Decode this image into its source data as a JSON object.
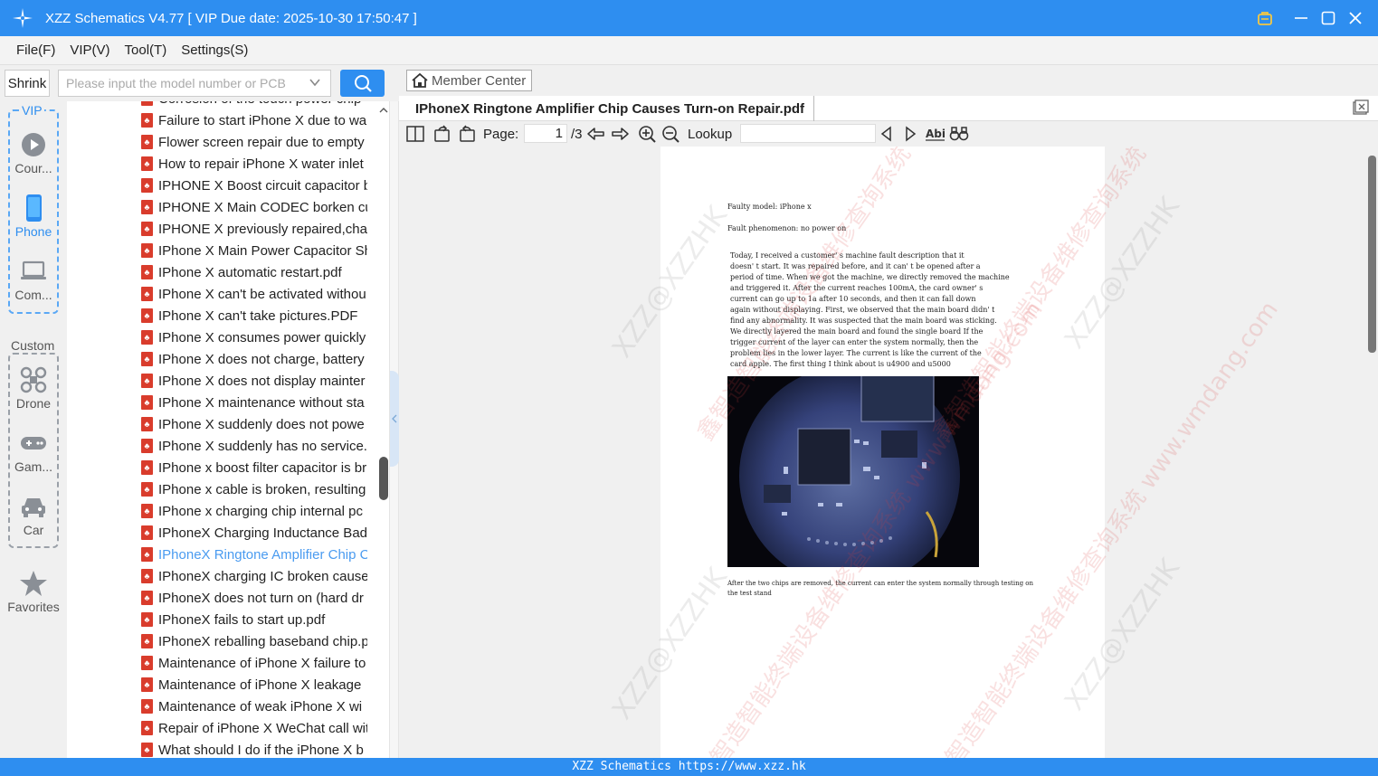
{
  "window": {
    "title": "XZZ Schematics V4.77 [ VIP Due date: 2025-10-30 17:50:47 ]"
  },
  "menu": [
    "File(F)",
    "VIP(V)",
    "Tool(T)",
    "Settings(S)"
  ],
  "toolbar": {
    "shrink_label": "Shrink",
    "search_placeholder": "Please input the model number or PCB"
  },
  "sidebar": {
    "vip_label": "VIP",
    "custom_label": "Custom",
    "items": [
      {
        "label": "Cour...",
        "icon": "play-circle-icon"
      },
      {
        "label": "Phone",
        "icon": "phone-icon"
      },
      {
        "label": "Com...",
        "icon": "laptop-icon"
      },
      {
        "label": "Drone",
        "icon": "drone-icon"
      },
      {
        "label": "Gam...",
        "icon": "gamepad-icon"
      },
      {
        "label": "Car",
        "icon": "car-icon"
      },
      {
        "label": "Favorites",
        "icon": "star-icon"
      }
    ]
  },
  "file_list": [
    "Corrosion of the touch power chip",
    "Failure to start iPhone X due to wa",
    "Flower screen repair due to empty",
    "How to repair iPhone X water inlet",
    "IPHONE X Boost circuit capacitor b",
    "IPHONE X Main CODEC borken cu",
    "IPHONE X previously repaired,char",
    "IPhone X Main Power Capacitor Sh",
    "IPhone X automatic restart.pdf",
    "IPhone X can't be activated withou",
    "IPhone X can't take pictures.PDF",
    "IPhone X consumes power quickly",
    "IPhone X does not charge, battery",
    "IPhone X does not display mainter",
    "IPhone X maintenance without sta",
    "IPhone X suddenly does not powe",
    "IPhone X suddenly has no service.p",
    "IPhone x boost filter capacitor is br",
    "IPhone x cable is broken, resulting",
    "IPhone x charging chip internal pc",
    "IPhoneX Charging Inductance Bad",
    "IPhoneX Ringtone Amplifier Chip C",
    "IPhoneX charging IC broken cause",
    "IPhoneX does not turn on (hard dr",
    "IPhoneX fails to start up.pdf",
    "IPhoneX reballing baseband chip.p",
    "Maintenance of iPhone X failure to",
    "Maintenance of iPhone X leakage",
    "Maintenance of weak iPhone X wi",
    "Repair of iPhone X WeChat call wit",
    "What should I do if the iPhone X b"
  ],
  "selected_index": 21,
  "viewer": {
    "member_center": "Member Center",
    "tab_title": "IPhoneX Ringtone Amplifier Chip Causes Turn-on Repair.pdf",
    "page_label": "Page:",
    "page_value": "1",
    "page_total": "/3",
    "lookup_label": "Lookup"
  },
  "document": {
    "model_line": "Faulty model: iPhone x",
    "phenomenon_line": "Fault phenomenon: no power on",
    "body_lines": [
      "Today, I received a customer' s machine fault description that it",
      "doesn' t start. It was repaired before, and it can' t be opened after a",
      "period of time. When we got the machine, we directly removed the machine",
      "and triggered it. After the current reaches 100mA, the card owner' s",
      "current can go up to 1a after 10 seconds, and then it can fall down",
      "again without displaying. First, we observed that the main board didn' t",
      "find any abnormality. It was suspected that the main board was sticking.",
      "We directly layered the main board and found the single board If the",
      "trigger current of the layer can enter the system normally, then the",
      "problem lies in the lower layer. The current is like the current of the",
      "card apple. The first thing I think about is u4900 and u5000"
    ],
    "caption_lines": [
      "After the two chips are removed, the current can enter the system normally through testing on",
      "the test stand"
    ],
    "watermark_red": "鑫智造智能终端设备维修查询系统 www.wmdang.com",
    "watermark_gray": "XZZ@XZZHK"
  },
  "statusbar": "XZZ Schematics https://www.xzz.hk",
  "colors": {
    "accent": "#2e8ef0",
    "pdf_icon": "#d93c2c",
    "selected_text": "#4a9bf0"
  }
}
